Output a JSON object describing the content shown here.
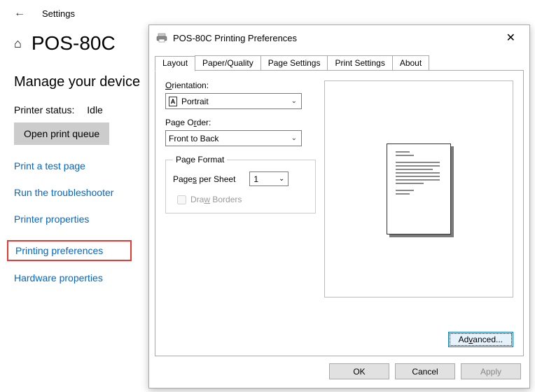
{
  "settings": {
    "header": "Settings",
    "printer_name": "POS-80C",
    "section": "Manage your device",
    "status_label": "Printer status:",
    "status_value": "Idle",
    "open_queue": "Open print queue",
    "links": {
      "test_page": "Print a test page",
      "troubleshooter": "Run the troubleshooter",
      "printer_properties": "Printer properties",
      "printing_preferences": "Printing preferences",
      "hardware_properties": "Hardware properties"
    }
  },
  "dialog": {
    "title": "POS-80C Printing Preferences",
    "tabs": [
      "Layout",
      "Paper/Quality",
      "Page Settings",
      "Print Settings",
      "About"
    ],
    "active_tab": "Layout",
    "orientation_label": "Orientation:",
    "orientation_value": "Portrait",
    "page_order_label": "Page Order:",
    "page_order_value": "Front to Back",
    "page_format_legend": "Page Format",
    "pages_per_sheet_label": "Pages per Sheet",
    "pages_per_sheet_value": "1",
    "draw_borders_label": "Draw Borders",
    "advanced_button": "Advanced...",
    "ok": "OK",
    "cancel": "Cancel",
    "apply": "Apply"
  }
}
